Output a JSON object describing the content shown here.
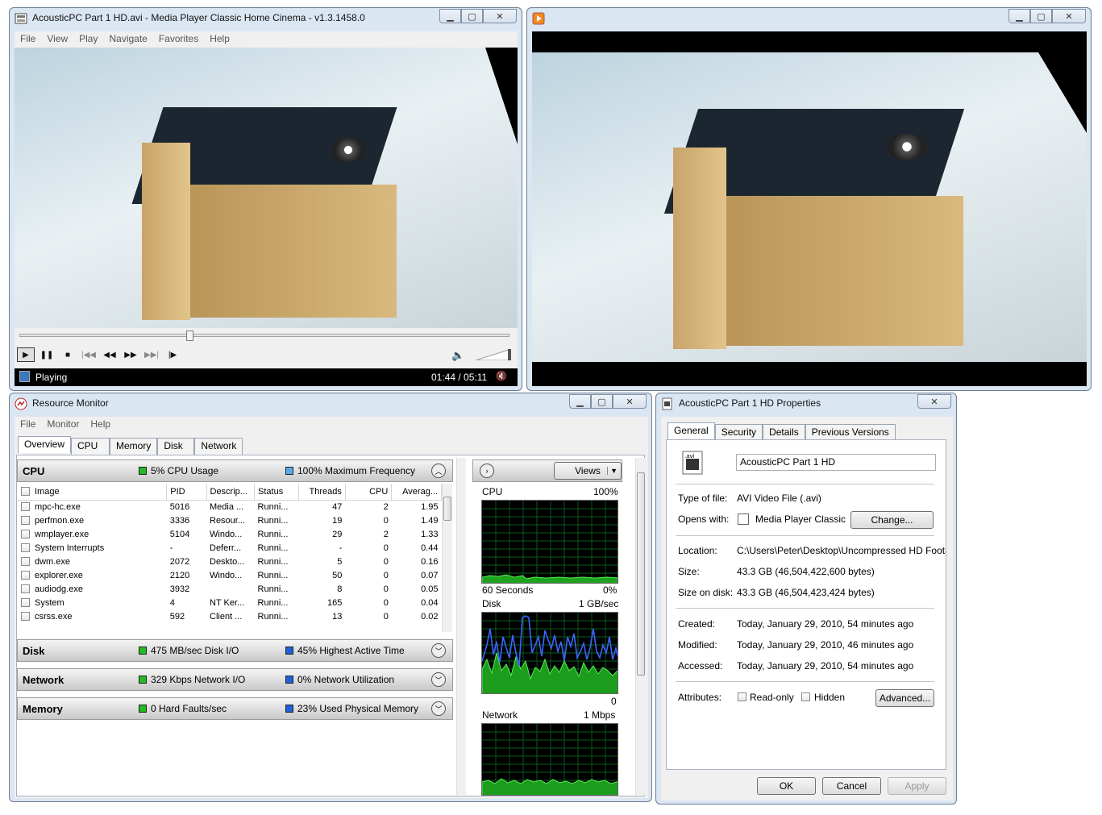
{
  "mpc": {
    "title": "AcousticPC Part 1 HD.avi - Media Player Classic Home Cinema - v1.3.1458.0",
    "menu": [
      "File",
      "View",
      "Play",
      "Navigate",
      "Favorites",
      "Help"
    ],
    "seek_progress": 0.34,
    "status": "Playing",
    "time": "01:44 / 05:11"
  },
  "player2": {
    "title": ""
  },
  "resmon": {
    "title": "Resource Monitor",
    "menu": [
      "File",
      "Monitor",
      "Help"
    ],
    "tabs": [
      "Overview",
      "CPU",
      "Memory",
      "Disk",
      "Network"
    ],
    "cpu": {
      "label": "CPU",
      "usage": "5% CPU Usage",
      "freq": "100% Maximum Frequency",
      "columns": [
        "Image",
        "PID",
        "Descrip...",
        "Status",
        "Threads",
        "CPU",
        "Averag..."
      ],
      "rows": [
        [
          "mpc-hc.exe",
          "5016",
          "Media ...",
          "Runni...",
          "47",
          "2",
          "1.95"
        ],
        [
          "perfmon.exe",
          "3336",
          "Resour...",
          "Runni...",
          "19",
          "0",
          "1.49"
        ],
        [
          "wmplayer.exe",
          "5104",
          "Windo...",
          "Runni...",
          "29",
          "2",
          "1.33"
        ],
        [
          "System Interrupts",
          "-",
          "Deferr...",
          "Runni...",
          "-",
          "0",
          "0.44"
        ],
        [
          "dwm.exe",
          "2072",
          "Deskto...",
          "Runni...",
          "5",
          "0",
          "0.16"
        ],
        [
          "explorer.exe",
          "2120",
          "Windo...",
          "Runni...",
          "50",
          "0",
          "0.07"
        ],
        [
          "audiodg.exe",
          "3932",
          "",
          "Runni...",
          "8",
          "0",
          "0.05"
        ],
        [
          "System",
          "4",
          "NT Ker...",
          "Runni...",
          "165",
          "0",
          "0.04"
        ],
        [
          "csrss.exe",
          "592",
          "Client ...",
          "Runni...",
          "13",
          "0",
          "0.02"
        ]
      ]
    },
    "disk": {
      "label": "Disk",
      "io": "475 MB/sec Disk I/O",
      "active": "45% Highest Active Time"
    },
    "network": {
      "label": "Network",
      "io": "329 Kbps Network I/O",
      "util": "0% Network Utilization"
    },
    "memory": {
      "label": "Memory",
      "faults": "0 Hard Faults/sec",
      "used": "23% Used Physical Memory"
    },
    "views_label": "Views",
    "graphs": {
      "cpu": {
        "label": "CPU",
        "max": "100%",
        "time": "60 Seconds",
        "min": "0%"
      },
      "disk": {
        "label": "Disk",
        "max": "1 GB/sec",
        "min": "0"
      },
      "network": {
        "label": "Network",
        "max": "1 Mbps"
      }
    }
  },
  "props": {
    "title": "AcousticPC Part 1 HD Properties",
    "tabs": [
      "General",
      "Security",
      "Details",
      "Previous Versions"
    ],
    "name": "AcousticPC Part 1 HD",
    "type_label": "Type of file:",
    "type_value": "AVI Video File (.avi)",
    "opens_label": "Opens with:",
    "opens_value": "Media Player Classic - H",
    "change_btn": "Change...",
    "location_label": "Location:",
    "location_value": "C:\\Users\\Peter\\Desktop\\Uncompressed HD Footag",
    "size_label": "Size:",
    "size_value": "43.3 GB (46,504,422,600 bytes)",
    "sizeondisk_label": "Size on disk:",
    "sizeondisk_value": "43.3 GB (46,504,423,424 bytes)",
    "created_label": "Created:",
    "created_value": "Today, January 29, 2010, 54 minutes ago",
    "modified_label": "Modified:",
    "modified_value": "Today, January 29, 2010, 46 minutes ago",
    "accessed_label": "Accessed:",
    "accessed_value": "Today, January 29, 2010, 54 minutes ago",
    "attributes_label": "Attributes:",
    "readonly": "Read-only",
    "hidden": "Hidden",
    "advanced_btn": "Advanced...",
    "ok": "OK",
    "cancel": "Cancel",
    "apply": "Apply"
  }
}
